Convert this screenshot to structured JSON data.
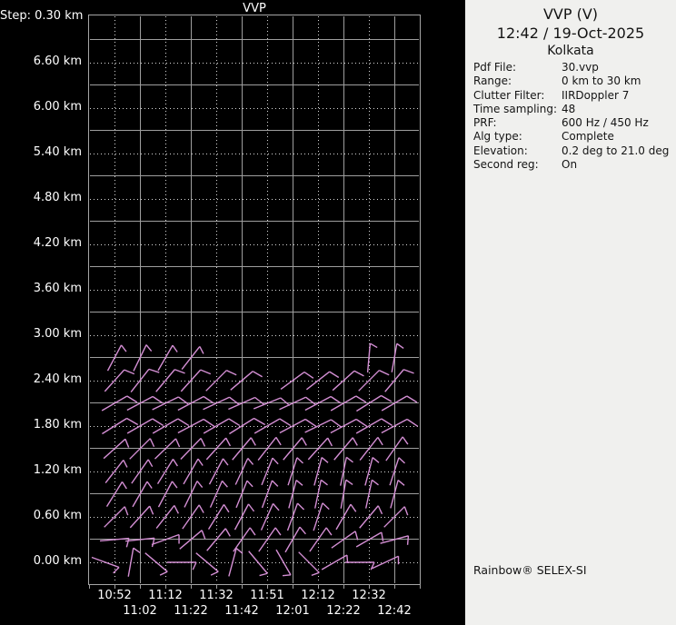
{
  "colors": {
    "background": "#000000",
    "panel_background": "#f0f0ee",
    "plot_text": "#ffffff",
    "grid_solid": "#9e9e9e",
    "grid_dotted": "#d9d9d9",
    "plot_border": "#a6a6a6",
    "barb": "#d48fd4",
    "panel_text": "#141414"
  },
  "plot": {
    "title": "VVP",
    "step_label": "Step: 0.30 km",
    "y_labels": [
      "6.60 km",
      "6.00 km",
      "5.40 km",
      "4.80 km",
      "4.20 km",
      "3.60 km",
      "3.00 km",
      "2.40 km",
      "1.80 km",
      "1.20 km",
      "0.60 km",
      "0.00 km"
    ],
    "x_labels": [
      "10:52",
      "11:02",
      "11:12",
      "11:22",
      "11:32",
      "11:42",
      "11:51",
      "12:01",
      "12:12",
      "12:22",
      "12:32",
      "12:42"
    ]
  },
  "panel": {
    "title": "VVP (V)",
    "datetime": "12:42 / 19-Oct-2025",
    "site": "Kolkata",
    "info": [
      {
        "label": "Pdf File:",
        "value": "30.vvp"
      },
      {
        "label": "Range:",
        "value": "0 km to 30 km"
      },
      {
        "label": "Clutter Filter:",
        "value": "IIRDoppler 7"
      },
      {
        "label": "Time sampling:",
        "value": "48"
      },
      {
        "label": "PRF:",
        "value": "600 Hz / 450 Hz"
      },
      {
        "label": "Alg type:",
        "value": "Complete"
      },
      {
        "label": "Elevation:",
        "value": "0.2 deg to 21.0 deg"
      },
      {
        "label": "Second reg:",
        "value": "On"
      }
    ],
    "footer": "Rainbow® SELEX-SI"
  },
  "chart_data": {
    "type": "scatter",
    "subtype": "wind-barb-time-height-profile",
    "title": "VVP",
    "xlabel": "time",
    "ylabel": "height",
    "x_ticks": [
      "10:52",
      "11:02",
      "11:12",
      "11:22",
      "11:32",
      "11:42",
      "11:51",
      "12:01",
      "12:12",
      "12:22",
      "12:32",
      "12:42"
    ],
    "y_ticks_km": [
      6.6,
      6.0,
      5.4,
      4.8,
      4.2,
      3.6,
      3.0,
      2.4,
      1.8,
      1.2,
      0.6,
      0.0
    ],
    "y_range_km": [
      0.0,
      7.2
    ],
    "height_step_km": 0.3,
    "grid": "solid major, dotted minor",
    "barb_rows": [
      {
        "alt_km": 2.7,
        "cols": [
          1,
          2,
          3,
          4,
          11,
          12
        ],
        "angles_deg": [
          62,
          64,
          60,
          52,
          85,
          80
        ],
        "tick_len": 9,
        "tick_rot": -115
      },
      {
        "alt_km": 2.4,
        "cols": [
          1,
          2,
          3,
          4,
          5,
          6,
          8,
          9,
          10,
          11,
          12
        ],
        "angles_deg": [
          48,
          52,
          50,
          48,
          45,
          40,
          36,
          38,
          42,
          45,
          50
        ],
        "tick_len": 12,
        "tick_rot": -70
      },
      {
        "alt_km": 2.1,
        "cols": [
          1,
          2,
          3,
          4,
          5,
          6,
          7,
          8,
          9,
          10,
          11,
          12
        ],
        "angles_deg": [
          30,
          28,
          26,
          28,
          25,
          24,
          22,
          25,
          28,
          30,
          32,
          30
        ],
        "tick_len": 13,
        "tick_rot": -62
      },
      {
        "alt_km": 1.8,
        "cols": [
          1,
          2,
          3,
          4,
          5,
          6,
          7,
          8,
          9,
          10,
          11,
          12
        ],
        "angles_deg": [
          32,
          30,
          30,
          28,
          30,
          32,
          30,
          28,
          26,
          28,
          30,
          28
        ],
        "tick_len": 14,
        "tick_rot": -62
      },
      {
        "alt_km": 1.5,
        "cols": [
          1,
          2,
          3,
          4,
          5,
          6,
          7,
          8,
          9,
          10,
          11,
          12
        ],
        "angles_deg": [
          42,
          45,
          44,
          46,
          48,
          50,
          52,
          50,
          48,
          50,
          52,
          55
        ],
        "tick_len": 10,
        "tick_rot": -110
      },
      {
        "alt_km": 1.2,
        "cols": [
          1,
          2,
          3,
          4,
          5,
          6,
          7,
          8,
          9,
          10,
          11,
          12
        ],
        "angles_deg": [
          52,
          55,
          58,
          60,
          62,
          65,
          68,
          72,
          75,
          78,
          75,
          72
        ],
        "tick_len": 9,
        "tick_rot": -115
      },
      {
        "alt_km": 0.9,
        "cols": [
          1,
          2,
          3,
          4,
          5,
          6,
          7,
          8,
          9,
          10,
          11,
          12
        ],
        "angles_deg": [
          58,
          60,
          62,
          64,
          66,
          68,
          70,
          75,
          78,
          80,
          78,
          75
        ],
        "tick_len": 9,
        "tick_rot": -115
      },
      {
        "alt_km": 0.6,
        "cols": [
          1,
          2,
          3,
          4,
          5,
          6,
          7,
          8,
          9,
          10,
          11,
          12
        ],
        "angles_deg": [
          45,
          48,
          52,
          55,
          58,
          62,
          66,
          70,
          72,
          60,
          50,
          45
        ],
        "tick_len": 10,
        "tick_rot": -115
      },
      {
        "alt_km": 0.3,
        "cols": [
          1,
          2,
          3,
          4,
          5,
          6,
          7,
          8,
          9,
          10,
          11,
          12
        ],
        "angles_deg": [
          5,
          6,
          20,
          40,
          50,
          55,
          55,
          60,
          55,
          35,
          30,
          15
        ],
        "tick_len": 10,
        "tick_rot": -110
      },
      {
        "alt_km": 0.0,
        "cols": [
          1,
          2,
          3,
          4,
          5,
          6,
          7,
          8,
          9,
          10,
          11,
          12
        ],
        "angles_deg": [
          -20,
          80,
          -40,
          0,
          -40,
          75,
          -50,
          -60,
          -45,
          30,
          0,
          25
        ],
        "tick_len": 9,
        "tick_rot": -115,
        "dx": -10
      }
    ]
  }
}
